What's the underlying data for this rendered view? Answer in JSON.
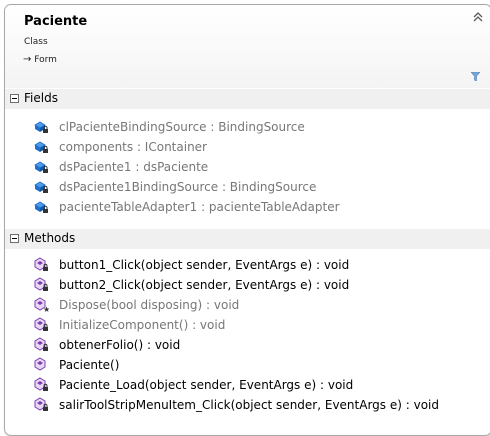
{
  "class_shape": {
    "name": "Paciente",
    "stereotype": "Class",
    "base_arrow": "→",
    "base_type": "Form"
  },
  "fields": {
    "label": "Fields",
    "items": [
      {
        "text": "clPacienteBindingSource : BindingSource",
        "access": "private"
      },
      {
        "text": "components : IContainer",
        "access": "private"
      },
      {
        "text": "dsPaciente1 : dsPaciente",
        "access": "private"
      },
      {
        "text": "dsPaciente1BindingSource : BindingSource",
        "access": "private"
      },
      {
        "text": "pacienteTableAdapter1 : pacienteTableAdapter",
        "access": "private"
      }
    ]
  },
  "methods": {
    "label": "Methods",
    "items": [
      {
        "text": "button1_Click(object sender, EventArgs e) : void",
        "access": "private"
      },
      {
        "text": "button2_Click(object sender, EventArgs e) : void",
        "access": "private"
      },
      {
        "text": "Dispose(bool disposing) : void",
        "access": "protected"
      },
      {
        "text": "InitializeComponent() : void",
        "access": "private"
      },
      {
        "text": "obtenerFolio() : void",
        "access": "private"
      },
      {
        "text": "Paciente()",
        "access": "public"
      },
      {
        "text": "Paciente_Load(object sender, EventArgs e) : void",
        "access": "private"
      },
      {
        "text": "salirToolStripMenuItem_Click(object sender, EventArgs e) : void",
        "access": "private"
      }
    ]
  },
  "colors": {
    "field_text": "#777777",
    "method_text": "#000000",
    "method_text_dimmed": "#777777",
    "field_icon": "#1e6fcf",
    "method_icon": "#7d3fb0"
  },
  "icons": {
    "collapse": "double-chevron-up-icon",
    "filter": "filter-icon",
    "field": "field-icon",
    "method": "method-icon"
  }
}
